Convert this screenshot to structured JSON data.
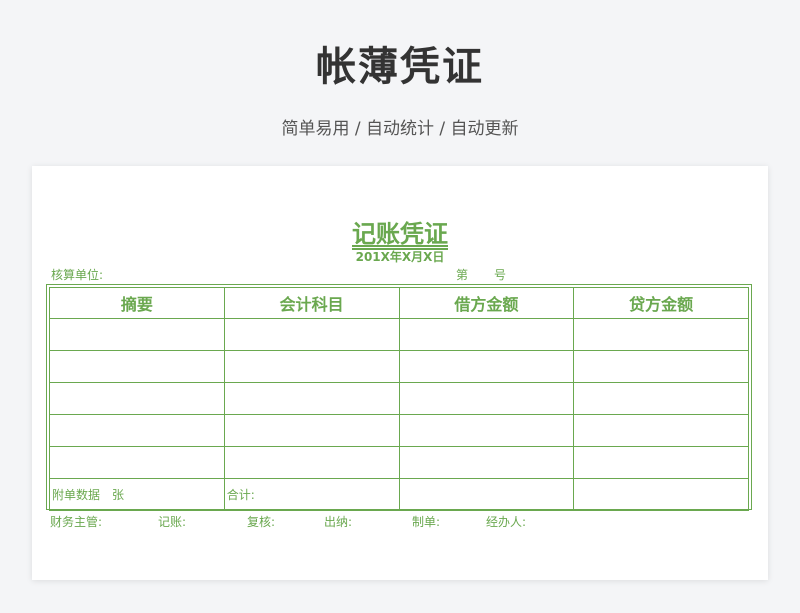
{
  "header": {
    "title": "帐薄凭证",
    "subtitle": "简单易用 / 自动统计 / 自动更新"
  },
  "voucher": {
    "title": "记账凭证",
    "date": "201X年X月X日",
    "unit_label": "核算单位:",
    "number_prefix": "第",
    "number_suffix": "号",
    "columns": [
      "摘要",
      "会计科目",
      "借方金额",
      "贷方金额"
    ],
    "footer": {
      "attachments": "附单数据　张",
      "total": "合计:"
    },
    "signatures": {
      "supervisor": "财务主管:",
      "bookkeeper": "记账:",
      "reviewer": "复核:",
      "cashier": "出纳:",
      "preparer": "制单:",
      "handler": "经办人:"
    }
  },
  "colors": {
    "accent": "#6aa84f",
    "background": "#f4f5f7",
    "title": "#333333"
  }
}
